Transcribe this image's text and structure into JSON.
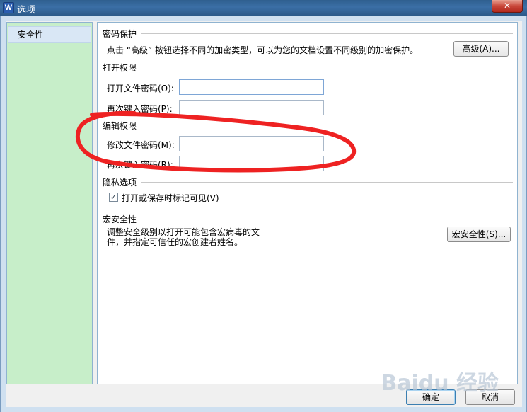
{
  "window": {
    "app_icon": "W",
    "title": "选项",
    "close_glyph": "✕"
  },
  "nav": {
    "items": [
      {
        "label": "安全性",
        "selected": true
      }
    ]
  },
  "password_protection": {
    "title": "密码保护",
    "description": "点击 “高级” 按钮选择不同的加密类型，可以为您的文档设置不同级别的加密保护。",
    "advanced_button": "高级(A)..."
  },
  "open_permission": {
    "title": "打开权限",
    "open_password_label": "打开文件密码(O):",
    "open_password_value": "",
    "confirm_password_label": "再次键入密码(P):",
    "confirm_password_value": ""
  },
  "edit_permission": {
    "title": "编辑权限",
    "modify_password_label": "修改文件密码(M):",
    "modify_password_value": "",
    "confirm_password_label": "再次键入密码(R):",
    "confirm_password_value": ""
  },
  "privacy": {
    "title": "隐私选项",
    "checkbox_label": "打开或保存时标记可见(V)",
    "checked": true
  },
  "macro_security": {
    "title": "宏安全性",
    "description_line1": "调整安全级别以打开可能包含宏病毒的文",
    "description_line2": "件，并指定可信任的宏创建者姓名。",
    "button": "宏安全性(S)..."
  },
  "footer": {
    "ok_button": "确定",
    "cancel_button": "取消"
  },
  "watermark": "Baidu 经验",
  "annotation": {
    "color": "#ee2222"
  }
}
